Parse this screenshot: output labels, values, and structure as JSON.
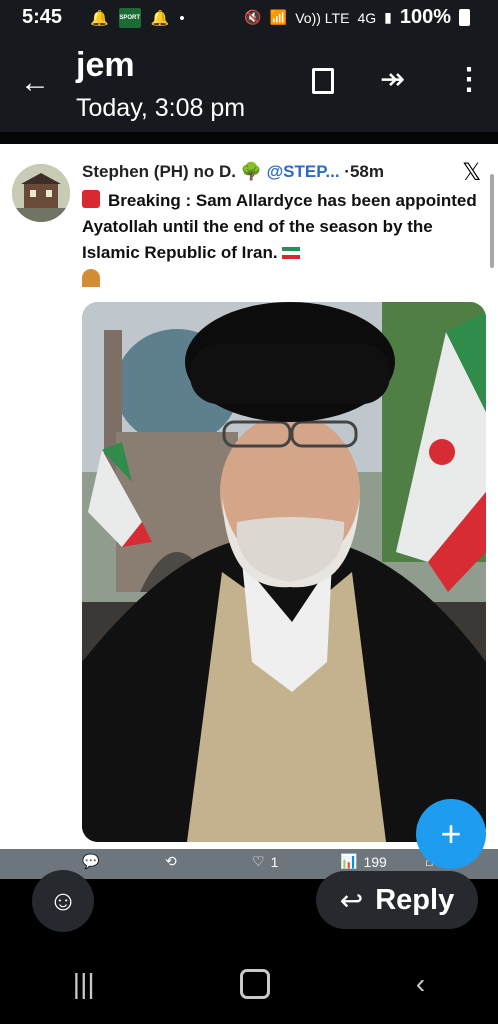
{
  "status": {
    "time": "5:45",
    "sport_badge": "SPORT",
    "network_top": "Vo)) LTE",
    "network_4g": "4G",
    "battery": "100%"
  },
  "header": {
    "title": "jem",
    "subtitle": "Today, 3:08 pm",
    "icons": [
      "back-arrow",
      "bookmark",
      "forward",
      "more-vertical"
    ]
  },
  "post": {
    "author": "Stephen (PH) no D.",
    "handle": "@STEP...",
    "time": "58m",
    "text": "Breaking : Sam Allardyce has been appointed Ayatollah until the end of the season by the Islamic Republic of Iran.",
    "likes": "1",
    "views": "199",
    "emoji": [
      "siren",
      "tree",
      "iran-flag",
      "mosque"
    ]
  },
  "composer": {
    "reply_label": "Reply"
  },
  "colors": {
    "accent": "#1e9cf0",
    "bar": "#16191d",
    "handle": "#2a6dc3"
  }
}
